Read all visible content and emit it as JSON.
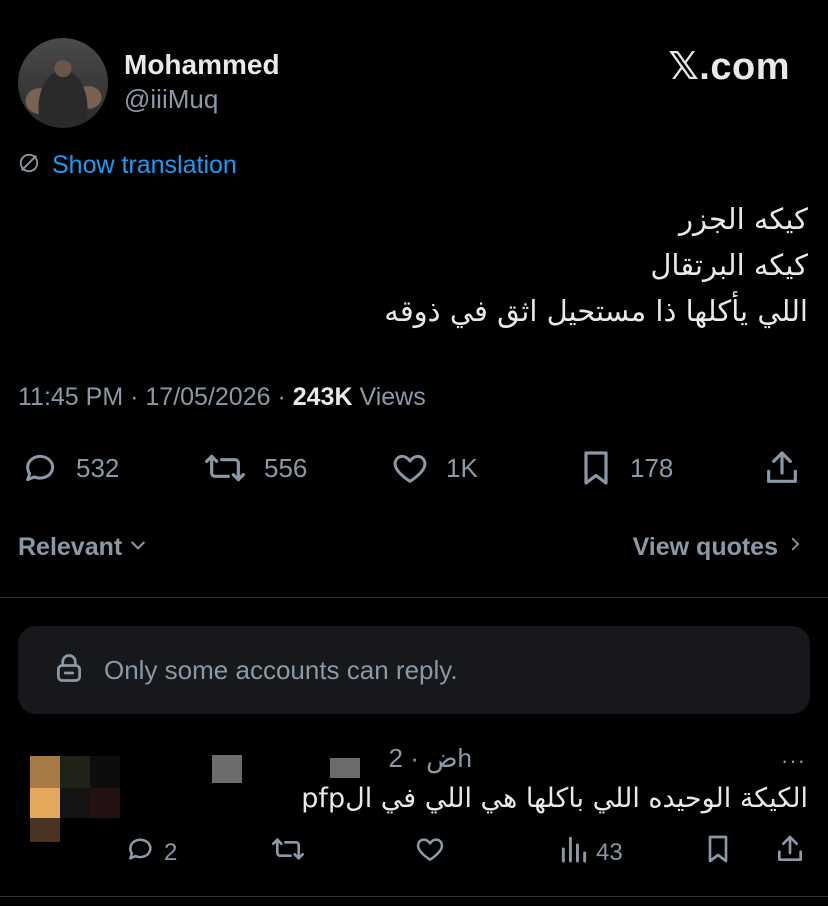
{
  "author": {
    "display_name": "Mohammed",
    "handle": "@iiiMuq",
    "avatar_icon": "profile-photo"
  },
  "brand": "𝕏.com",
  "translation": {
    "label": "Show translation",
    "icon": "globe-slash-icon",
    "color": "#1d9bf0"
  },
  "tweet": {
    "lines": [
      "كيكه الجزر",
      "كيكه البرتقال",
      "اللي يأكلها ذا مستحيل اثق في ذوقه"
    ]
  },
  "meta": {
    "time": "11:45 PM",
    "date": "17/05/2026",
    "separator": "·",
    "views_count": "243K",
    "views_label": "Views"
  },
  "actions": {
    "replies": "532",
    "reposts": "556",
    "likes": "1K",
    "bookmarks": "178"
  },
  "filter": {
    "sort_label": "Relevant",
    "quotes_label": "View quotes"
  },
  "reply_restriction": {
    "label": "Only some accounts can reply."
  },
  "reply": {
    "time": "ض · 2h",
    "more": "···",
    "text": "الكيكة الوحيده اللي باكلها هي اللي في الpfp",
    "actions": {
      "replies": "2",
      "reposts": "",
      "likes": "",
      "views": "43"
    }
  },
  "colors": {
    "background": "#000000",
    "text": "#e7e9ea",
    "muted": "#8b98a5",
    "accent": "#1d9bf0",
    "divider": "#2f3336"
  }
}
